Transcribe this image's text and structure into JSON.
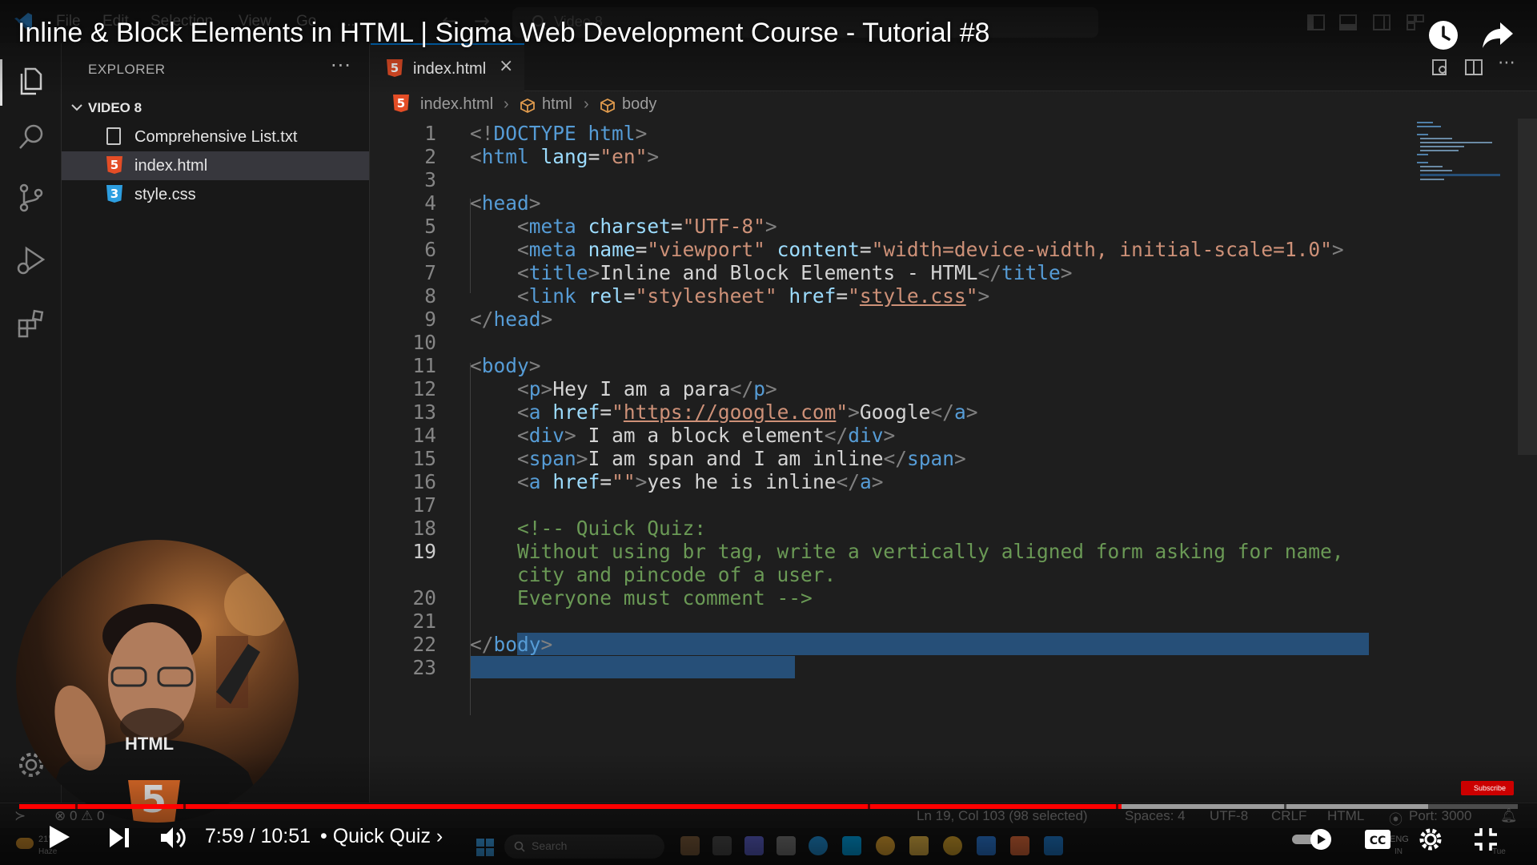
{
  "menu": [
    "File",
    "Edit",
    "Selection",
    "View",
    "Go",
    "..."
  ],
  "search": {
    "placeholder": "Video 8"
  },
  "sidebar": {
    "title": "EXPLORER",
    "more": "···",
    "folder": "VIDEO 8",
    "files": [
      {
        "name": "Comprehensive List.txt",
        "icon": "text-file-icon",
        "selected": false
      },
      {
        "name": "index.html",
        "icon": "html5-file-icon",
        "selected": true
      },
      {
        "name": "style.css",
        "icon": "css3-file-icon",
        "selected": false
      }
    ]
  },
  "tab": {
    "label": "index.html",
    "close": "×",
    "html_glyph": "5",
    "css_glyph": "3"
  },
  "breadcrumb": [
    "index.html",
    "html",
    "body"
  ],
  "editor": {
    "active_line": 19,
    "lines": [
      {
        "n": "1",
        "text": "<!DOCTYPE html>"
      },
      {
        "n": "2",
        "text": "<html lang=\"en\">"
      },
      {
        "n": "3",
        "text": ""
      },
      {
        "n": "4",
        "text": "<head>"
      },
      {
        "n": "5",
        "text": "    <meta charset=\"UTF-8\">"
      },
      {
        "n": "6",
        "text": "    <meta name=\"viewport\" content=\"width=device-width, initial-scale=1.0\">"
      },
      {
        "n": "7",
        "text": "    <title>Inline and Block Elements - HTML</title>"
      },
      {
        "n": "8",
        "text": "    <link rel=\"stylesheet\" href=\"style.css\">"
      },
      {
        "n": "9",
        "text": "</head>"
      },
      {
        "n": "10",
        "text": ""
      },
      {
        "n": "11",
        "text": "<body>"
      },
      {
        "n": "12",
        "text": "    <p>Hey I am a para</p>"
      },
      {
        "n": "13",
        "text": "    <a href=\"https://google.com\">Google</a>"
      },
      {
        "n": "14",
        "text": "    <div> I am a block element</div>"
      },
      {
        "n": "15",
        "text": "    <span>I am span and I am inline</span>"
      },
      {
        "n": "16",
        "text": "    <a href=\"\">yes he is inline</a>"
      },
      {
        "n": "17",
        "text": ""
      },
      {
        "n": "18",
        "text": "    <!-- Quick Quiz:"
      },
      {
        "n": "19",
        "text": "    Without using br tag, write a vertically aligned form asking for name,"
      },
      {
        "n": "",
        "text": "    city and pincode of a user."
      },
      {
        "n": "20",
        "text": "    Everyone must comment -->"
      },
      {
        "n": "21",
        "text": ""
      },
      {
        "n": "22",
        "text": "</body>"
      },
      {
        "n": "23",
        "text": ""
      }
    ]
  },
  "statusbar": {
    "errors": "⊗ 0 ⚠ 0",
    "cursor": "Ln 19, Col 103 (98 selected)",
    "spaces": "Spaces: 4",
    "encoding": "UTF-8",
    "eol": "CRLF",
    "language": "HTML",
    "port": "Port: 3000"
  },
  "taskbar": {
    "search_placeholder": "Search",
    "weather": "21°",
    "weather_desc": "Haze",
    "lang": "ENG",
    "lang_sub": "IN",
    "day": "Tue"
  },
  "video": {
    "title": "Inline & Block Elements in HTML | Sigma Web Development Course - Tutorial #8",
    "time": "7:59 / 10:51",
    "chapter": "• Quick Quiz",
    "chapter_chevron": "›",
    "progress": 0.7357,
    "buffered": 0.94,
    "subscribe": "Subscribe",
    "webcam_shirt_text": "HTML"
  }
}
